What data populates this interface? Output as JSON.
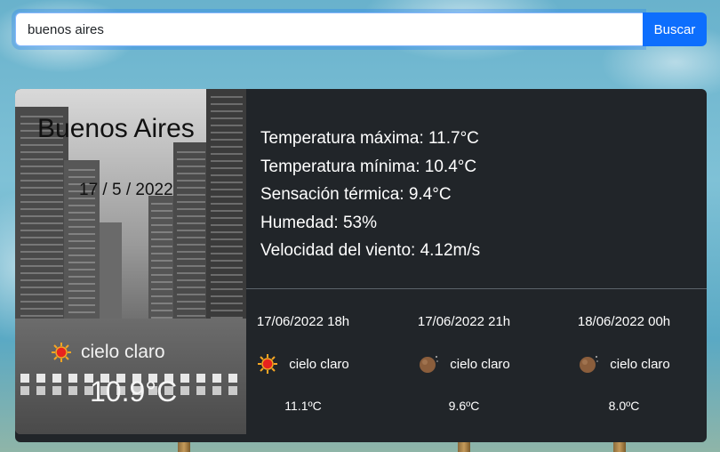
{
  "search": {
    "value": "buenos aires",
    "button_label": "Buscar"
  },
  "current": {
    "city": "Buenos Aires",
    "date": "17 / 5 / 2022",
    "icon": "sun-icon",
    "description": "cielo claro",
    "temperature": "10.9°C"
  },
  "details": [
    "Temperatura máxima: 11.7°C",
    "Temperatura mínima: 10.4°C",
    "Sensación térmica: 9.4°C",
    "Humedad: 53%",
    "Velocidad del viento: 4.12m/s"
  ],
  "forecast": [
    {
      "time": "17/06/2022 18h",
      "icon": "sun-icon",
      "description": "cielo claro",
      "temperature": "11.1ºC"
    },
    {
      "time": "17/06/2022 21h",
      "icon": "moon-icon",
      "description": "cielo claro",
      "temperature": "9.6ºC"
    },
    {
      "time": "18/06/2022 00h",
      "icon": "moon-icon",
      "description": "cielo claro",
      "temperature": "8.0ºC"
    }
  ],
  "colors": {
    "button": "#0d6efd",
    "card": "#212529"
  }
}
